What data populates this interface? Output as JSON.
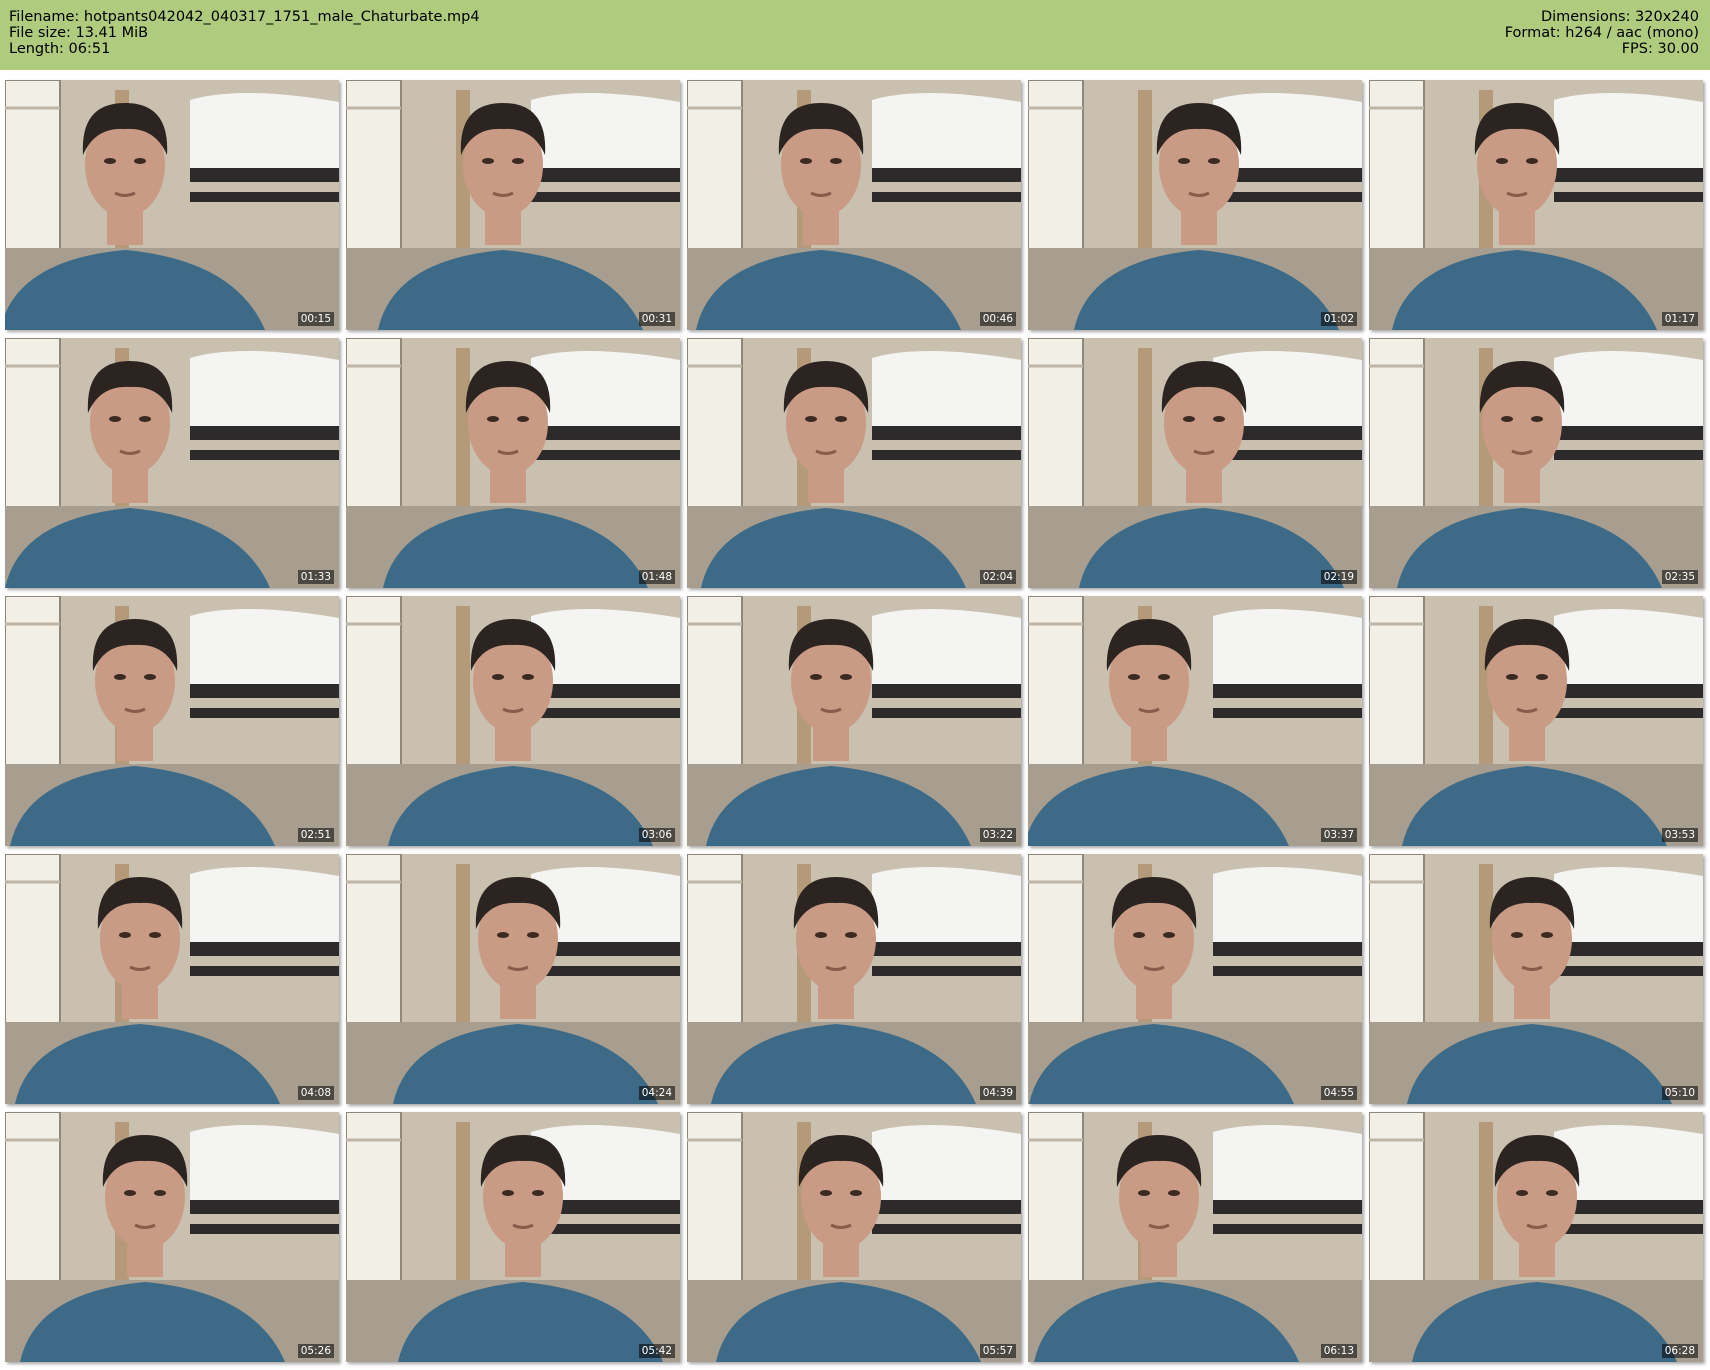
{
  "header": {
    "filename_line": "Filename: hotpants042042_040317_1751_male_Chaturbate.mp4",
    "filesize_line": "File size: 13.41 MiB",
    "length_line": "Length: 06:51",
    "dimensions_line": "Dimensions: 320x240",
    "format_line": "Format: h264 / aac (mono)",
    "fps_line": "FPS: 30.00"
  },
  "colors": {
    "header_bg": "#aecb7e",
    "page_bg": "#ffffff",
    "wall": "#c9c0b0",
    "shirt": "#3d6a86",
    "hair": "#2b2420",
    "skin": "#c99a84",
    "window": "#f2efe6",
    "bedding": "#f4f4f2",
    "shelf": "#2c2a2a"
  },
  "thumbnails": [
    {
      "time": "00:15",
      "icon": "webcam-frame"
    },
    {
      "time": "00:31",
      "icon": "webcam-frame"
    },
    {
      "time": "00:46",
      "icon": "webcam-frame"
    },
    {
      "time": "01:02",
      "icon": "webcam-frame"
    },
    {
      "time": "01:17",
      "icon": "webcam-frame"
    },
    {
      "time": "01:33",
      "icon": "webcam-frame"
    },
    {
      "time": "01:48",
      "icon": "webcam-frame"
    },
    {
      "time": "02:04",
      "icon": "webcam-frame"
    },
    {
      "time": "02:19",
      "icon": "webcam-frame"
    },
    {
      "time": "02:35",
      "icon": "webcam-frame"
    },
    {
      "time": "02:51",
      "icon": "webcam-frame"
    },
    {
      "time": "03:06",
      "icon": "webcam-frame"
    },
    {
      "time": "03:22",
      "icon": "webcam-frame"
    },
    {
      "time": "03:37",
      "icon": "webcam-frame"
    },
    {
      "time": "03:53",
      "icon": "webcam-frame"
    },
    {
      "time": "04:08",
      "icon": "webcam-frame"
    },
    {
      "time": "04:24",
      "icon": "webcam-frame"
    },
    {
      "time": "04:39",
      "icon": "webcam-frame"
    },
    {
      "time": "04:55",
      "icon": "webcam-frame"
    },
    {
      "time": "05:10",
      "icon": "webcam-frame"
    },
    {
      "time": "05:26",
      "icon": "webcam-frame"
    },
    {
      "time": "05:42",
      "icon": "webcam-frame"
    },
    {
      "time": "05:57",
      "icon": "webcam-frame"
    },
    {
      "time": "06:13",
      "icon": "webcam-frame"
    },
    {
      "time": "06:28",
      "icon": "webcam-frame"
    }
  ]
}
